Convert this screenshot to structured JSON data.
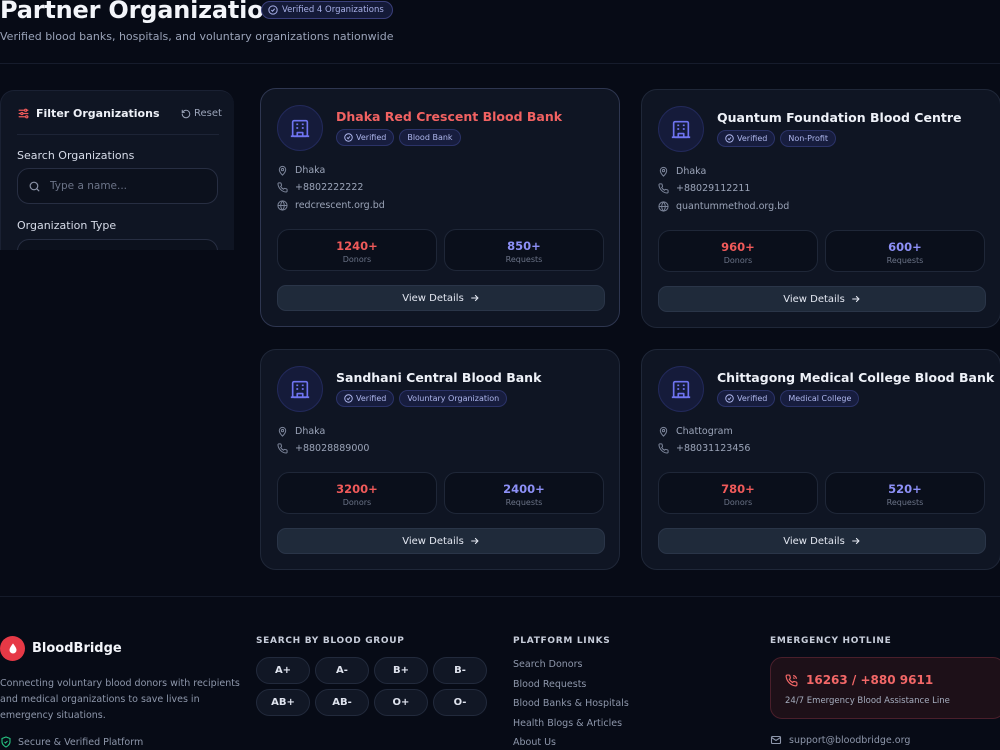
{
  "header": {
    "title": "Partner Organizations",
    "badge": "Verified 4 Organizations",
    "subtitle": "Verified blood banks, hospitals, and voluntary organizations nationwide"
  },
  "filter": {
    "title": "Filter Organizations",
    "reset_label": "Reset",
    "search_label": "Search Organizations",
    "search_placeholder": "Type a name...",
    "type_label": "Organization Type"
  },
  "organizations": [
    {
      "name": "Dhaka Red Crescent Blood Bank",
      "verified_label": "Verified",
      "type": "Blood Bank",
      "location": "Dhaka",
      "phone": "+8802222222",
      "website": "redcrescent.org.bd",
      "donors": "1240+",
      "requests": "850+",
      "donors_label": "Donors",
      "requests_label": "Requests",
      "cta": "View Details"
    },
    {
      "name": "Quantum Foundation Blood Centre",
      "verified_label": "Verified",
      "type": "Non-Profit",
      "location": "Dhaka",
      "phone": "+88029112211",
      "website": "quantummethod.org.bd",
      "donors": "960+",
      "requests": "600+",
      "donors_label": "Donors",
      "requests_label": "Requests",
      "cta": "View Details"
    },
    {
      "name": "Sandhani Central Blood Bank",
      "verified_label": "Verified",
      "type": "Voluntary Organization",
      "location": "Dhaka",
      "phone": "+88028889000",
      "donors": "3200+",
      "requests": "2400+",
      "donors_label": "Donors",
      "requests_label": "Requests",
      "cta": "View Details"
    },
    {
      "name": "Chittagong Medical College Blood Bank",
      "verified_label": "Verified",
      "type": "Medical College",
      "location": "Chattogram",
      "phone": "+88031123456",
      "donors": "780+",
      "requests": "520+",
      "donors_label": "Donors",
      "requests_label": "Requests",
      "cta": "View Details"
    }
  ],
  "footer": {
    "brand": "BloodBridge",
    "description": "Connecting voluntary blood donors with recipients and medical organizations to save lives in emergency situations.",
    "secure": "Secure & Verified Platform",
    "blood_group_heading": "SEARCH BY BLOOD GROUP",
    "blood_groups": [
      "A+",
      "A-",
      "B+",
      "B-",
      "AB+",
      "AB-",
      "O+",
      "O-"
    ],
    "links_heading": "PLATFORM LINKS",
    "links": [
      "Search Donors",
      "Blood Requests",
      "Blood Banks & Hospitals",
      "Health Blogs & Articles",
      "About Us"
    ],
    "hotline_heading": "EMERGENCY HOTLINE",
    "hotline_number": "16263 / +880 9611",
    "hotline_sub": "24/7 Emergency Blood Assistance Line",
    "support_email": "support@bloodbridge.org"
  },
  "colors": {
    "background": "#070b16",
    "card": "#0f1523",
    "accent_red": "#f05a5a",
    "accent_blue": "#8d90f7"
  }
}
